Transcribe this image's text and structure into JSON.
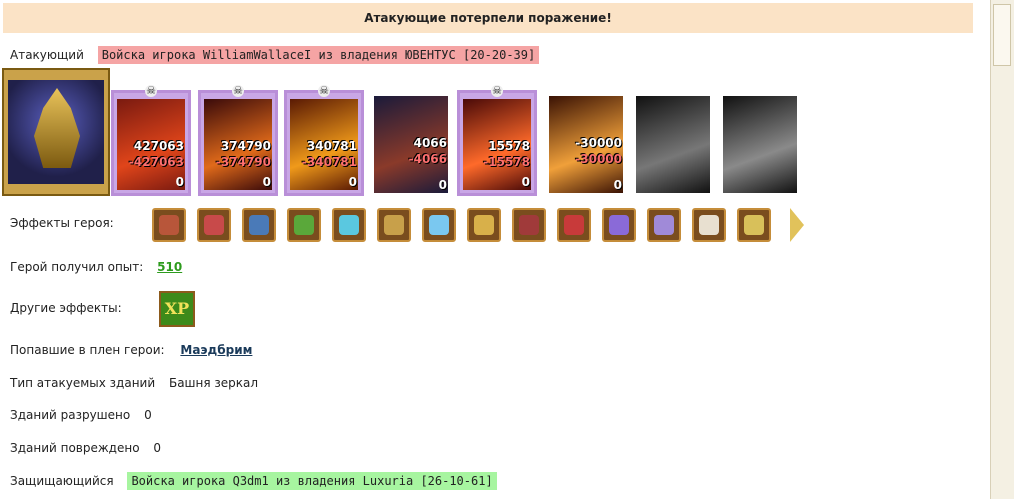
{
  "result_title": "Атакующие потерпели поражение!",
  "attacker": {
    "label": "Атакующий",
    "army_tag": "Войска игрока WilliamWallaceI из владения ЮВЕНТУС [20-20-39]",
    "units": [
      {
        "top": "427063",
        "loss": "-427063",
        "left": "0",
        "colors": [
          "#7a1a10",
          "#e0451a"
        ]
      },
      {
        "top": "374790",
        "loss": "-374790",
        "left": "0",
        "colors": [
          "#3a0a0a",
          "#e06a1a"
        ]
      },
      {
        "top": "340781",
        "loss": "-340781",
        "left": "0",
        "colors": [
          "#5a1a04",
          "#f09a1a"
        ]
      },
      {
        "top": "4066",
        "loss": "-4066",
        "left": "0",
        "colors": [
          "#1a1a3a",
          "#8a3a2a"
        ]
      },
      {
        "top": "15578",
        "loss": "-15578",
        "left": "0",
        "colors": [
          "#4a0a08",
          "#ff6a2a"
        ]
      },
      {
        "top": "-30000",
        "loss": "-30000",
        "left": "0",
        "colors": [
          "#3a1204",
          "#f0a03a"
        ]
      },
      {
        "top": "",
        "loss": "",
        "left": "",
        "colors": [
          "#111111",
          "#777777"
        ]
      },
      {
        "top": "",
        "loss": "",
        "left": "",
        "colors": [
          "#111111",
          "#8a8a8a"
        ]
      }
    ]
  },
  "hero_effects_label": "Эффекты героя:",
  "hero_effects": [
    {
      "icon": "shield-crest-icon",
      "color": "#b8563a"
    },
    {
      "icon": "dice-icon",
      "color": "#c84a4a"
    },
    {
      "icon": "shield-icon",
      "color": "#4a7ab8"
    },
    {
      "icon": "hand-shield-icon",
      "color": "#5aa83a"
    },
    {
      "icon": "sword-icon",
      "color": "#5ac8e0"
    },
    {
      "icon": "handshake-icon",
      "color": "#c8a04a"
    },
    {
      "icon": "magic-hand-icon",
      "color": "#7ac8f0"
    },
    {
      "icon": "scroll-icon",
      "color": "#d8b04a"
    },
    {
      "icon": "helmet-icon",
      "color": "#a03a3a"
    },
    {
      "icon": "cross-shield-icon",
      "color": "#c83a3a"
    },
    {
      "icon": "spider-icon",
      "color": "#8a6ad8"
    },
    {
      "icon": "ring-icon",
      "color": "#a08ad8"
    },
    {
      "icon": "scroll-paper-icon",
      "color": "#e8e0d0"
    },
    {
      "icon": "dagger-icon",
      "color": "#d8c05a"
    }
  ],
  "experience": {
    "label": "Герой получил опыт:",
    "value": "510"
  },
  "other_effects": {
    "label": "Другие эффекты:",
    "xp_text": "XP"
  },
  "captured": {
    "label": "Попавшие в плен герои:",
    "hero": "Маэдбрим"
  },
  "building_type": {
    "label": "Тип атакуемых зданий",
    "value": "Башня зеркал"
  },
  "destroyed": {
    "label": "Зданий разрушено",
    "value": "0"
  },
  "damaged": {
    "label": "Зданий повреждено",
    "value": "0"
  },
  "defender": {
    "label": "Защищающийся",
    "army_tag": "Войска игрока Q3dm1 из владения Luxuria [26-10-61]"
  }
}
